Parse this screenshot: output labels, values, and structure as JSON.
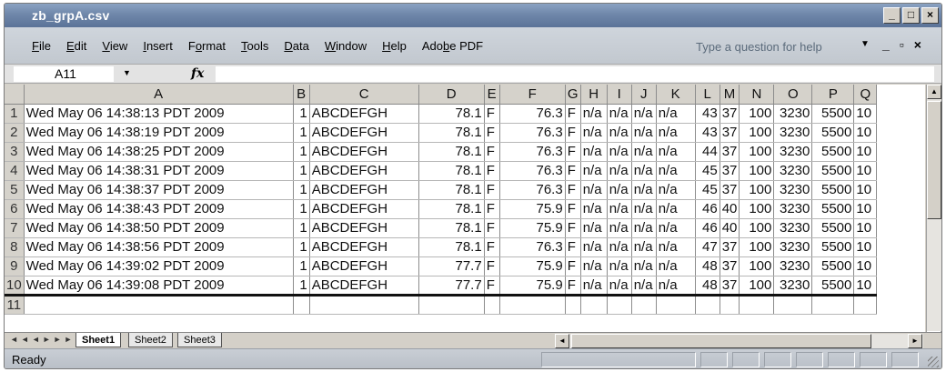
{
  "window": {
    "title": "zb_grpA.csv"
  },
  "title_buttons": [
    "_",
    "□",
    "×"
  ],
  "menu": [
    {
      "label": "File",
      "key": "F"
    },
    {
      "label": "Edit",
      "key": "E"
    },
    {
      "label": "View",
      "key": "V"
    },
    {
      "label": "Insert",
      "key": "I"
    },
    {
      "label": "Format",
      "key": "o"
    },
    {
      "label": "Tools",
      "key": "T"
    },
    {
      "label": "Data",
      "key": "D"
    },
    {
      "label": "Window",
      "key": "W"
    },
    {
      "label": "Help",
      "key": "H"
    },
    {
      "label": "Adobe PDF",
      "key": "b"
    }
  ],
  "help_placeholder": "Type a question for help",
  "doc_controls": [
    "_",
    "▫",
    "×"
  ],
  "formula_bar": {
    "name_box": "A11",
    "fx": "fx",
    "formula": ""
  },
  "columns": [
    "A",
    "B",
    "C",
    "D",
    "E",
    "F",
    "G",
    "H",
    "I",
    "J",
    "K",
    "L",
    "M",
    "N",
    "O",
    "P",
    "Q"
  ],
  "rows": [
    [
      "1",
      "Wed May 06 14:38:13 PDT 2009",
      "1",
      "ABCDEFGH",
      "78.1",
      "F",
      "76.3",
      "F",
      "n/a",
      "n/a",
      "n/a",
      "n/a",
      "43",
      "37",
      "100",
      "3230",
      "5500",
      "10"
    ],
    [
      "2",
      "Wed May 06 14:38:19 PDT 2009",
      "1",
      "ABCDEFGH",
      "78.1",
      "F",
      "76.3",
      "F",
      "n/a",
      "n/a",
      "n/a",
      "n/a",
      "43",
      "37",
      "100",
      "3230",
      "5500",
      "10"
    ],
    [
      "3",
      "Wed May 06 14:38:25 PDT 2009",
      "1",
      "ABCDEFGH",
      "78.1",
      "F",
      "76.3",
      "F",
      "n/a",
      "n/a",
      "n/a",
      "n/a",
      "44",
      "37",
      "100",
      "3230",
      "5500",
      "10"
    ],
    [
      "4",
      "Wed May 06 14:38:31 PDT 2009",
      "1",
      "ABCDEFGH",
      "78.1",
      "F",
      "76.3",
      "F",
      "n/a",
      "n/a",
      "n/a",
      "n/a",
      "45",
      "37",
      "100",
      "3230",
      "5500",
      "10"
    ],
    [
      "5",
      "Wed May 06 14:38:37 PDT 2009",
      "1",
      "ABCDEFGH",
      "78.1",
      "F",
      "76.3",
      "F",
      "n/a",
      "n/a",
      "n/a",
      "n/a",
      "45",
      "37",
      "100",
      "3230",
      "5500",
      "10"
    ],
    [
      "6",
      "Wed May 06 14:38:43 PDT 2009",
      "1",
      "ABCDEFGH",
      "78.1",
      "F",
      "75.9",
      "F",
      "n/a",
      "n/a",
      "n/a",
      "n/a",
      "46",
      "40",
      "100",
      "3230",
      "5500",
      "10"
    ],
    [
      "7",
      "Wed May 06 14:38:50 PDT 2009",
      "1",
      "ABCDEFGH",
      "78.1",
      "F",
      "75.9",
      "F",
      "n/a",
      "n/a",
      "n/a",
      "n/a",
      "46",
      "40",
      "100",
      "3230",
      "5500",
      "10"
    ],
    [
      "8",
      "Wed May 06 14:38:56 PDT 2009",
      "1",
      "ABCDEFGH",
      "78.1",
      "F",
      "76.3",
      "F",
      "n/a",
      "n/a",
      "n/a",
      "n/a",
      "47",
      "37",
      "100",
      "3230",
      "5500",
      "10"
    ],
    [
      "9",
      "Wed May 06 14:39:02 PDT 2009",
      "1",
      "ABCDEFGH",
      "77.7",
      "F",
      "75.9",
      "F",
      "n/a",
      "n/a",
      "n/a",
      "n/a",
      "48",
      "37",
      "100",
      "3230",
      "5500",
      "10"
    ],
    [
      "10",
      "Wed May 06 14:39:08 PDT 2009",
      "1",
      "ABCDEFGH",
      "77.7",
      "F",
      "75.9",
      "F",
      "n/a",
      "n/a",
      "n/a",
      "n/a",
      "48",
      "37",
      "100",
      "3230",
      "5500",
      "10"
    ],
    [
      "11",
      "",
      "",
      "",
      "",
      "",
      "",
      "",
      "",
      "",
      "",
      "",
      "",
      "",
      "",
      "",
      "",
      ""
    ]
  ],
  "sheet_tabs": [
    "Sheet1",
    "Sheet2",
    "Sheet3"
  ],
  "active_sheet": "Sheet1",
  "status": "Ready",
  "colors": {
    "title_bar": "#6f87aa",
    "chrome": "#d4d0c8",
    "header": "#d5d2cb"
  }
}
